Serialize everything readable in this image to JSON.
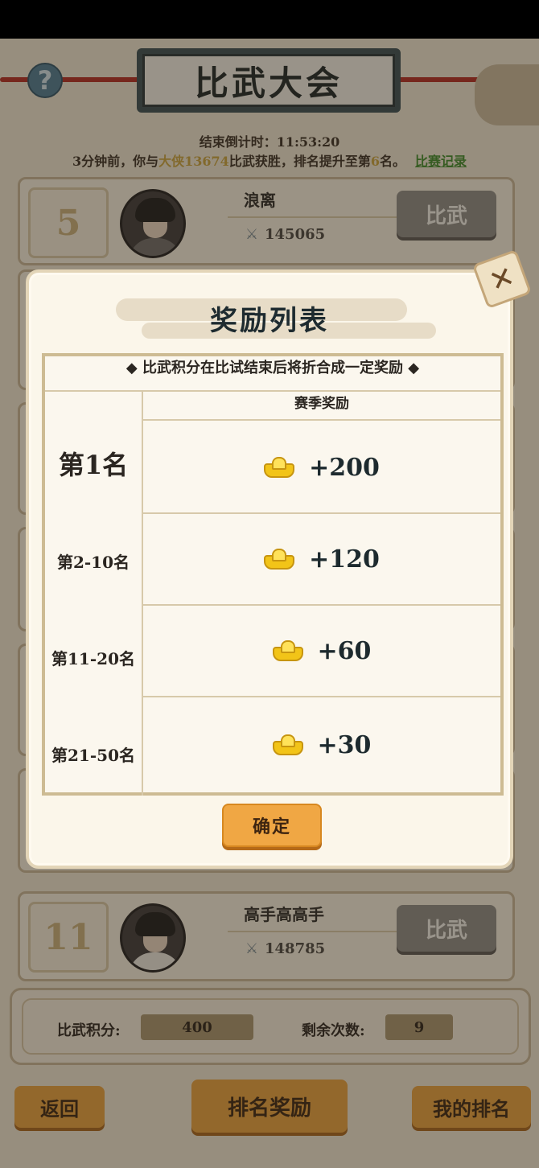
{
  "header": {
    "title": "比武大会",
    "countdown": "结束倒计时：11:53:20",
    "notice_prefix": "3分钟前，你与",
    "notice_opponent": "大侠13674",
    "notice_mid": "比武获胜，排名提升至第",
    "notice_rank": "6",
    "notice_suffix": "名。",
    "record_link": "比赛记录"
  },
  "rows": [
    {
      "rank": "5",
      "name": "浪离",
      "power": "145065",
      "button": "比武"
    },
    {
      "rank": "11",
      "name": "高手高高手",
      "power": "148785",
      "button": "比武"
    }
  ],
  "stats": {
    "score_label": "比武积分:",
    "score_value": "400",
    "remaining_label": "剩余次数:",
    "remaining_value": "9"
  },
  "bottom_nav": {
    "back": "返回",
    "rank_rewards": "排名奖励",
    "my_rank": "我的排名"
  },
  "modal": {
    "title": "奖励列表",
    "caption": "◆ 比武积分在比试结束后将折合成一定奖励 ◆",
    "column_header": "赛季奖励",
    "rewards": [
      {
        "rank": "第1名",
        "amount": "+200"
      },
      {
        "rank": "第2-10名",
        "amount": "+120"
      },
      {
        "rank": "第11-20名",
        "amount": "+60"
      },
      {
        "rank": "第21-50名",
        "amount": "+30"
      }
    ],
    "confirm": "确定",
    "reward_icon": "gold-ingot-icon"
  },
  "colors": {
    "accent_orange": "#f0a744",
    "rope_red": "#b22a22",
    "title_board": "#394d52"
  }
}
